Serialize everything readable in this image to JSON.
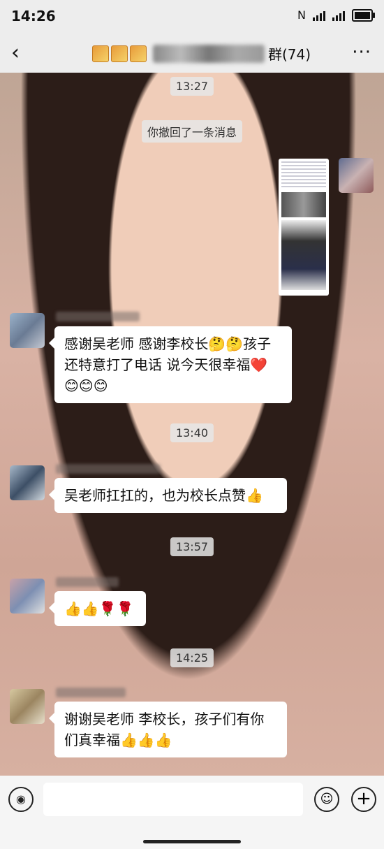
{
  "status_bar": {
    "time": "14:26",
    "nfc": "N",
    "battery_icon": "battery-charging-icon"
  },
  "header": {
    "title_suffix": "群(74)",
    "back_icon": "chevron-left-icon",
    "more_icon": "more-horizontal-icon",
    "back_glyph": "‹",
    "more_glyph": "···"
  },
  "messages": {
    "ts1": "13:27",
    "recall_notice": "你撤回了一条消息",
    "m1_line1": "感谢吴老师 感谢李校长🤔🤔孩子",
    "m1_line2": "还特意打了电话 说今天很幸福❤️",
    "m1_line3": "😊😊😊",
    "ts2": "13:40",
    "m2": "吴老师扛扛的，也为校长点赞👍",
    "ts3": "13:57",
    "m3": "👍👍🌹🌹",
    "ts4": "14:25",
    "m4_line1": "谢谢吴老师 李校长，孩子们有你",
    "m4_line2": "们真幸福👍👍👍"
  },
  "composer": {
    "voice_icon": "voice-icon",
    "emoji_icon": "emoji-icon",
    "plus_icon": "plus-icon",
    "voice_glyph": "◉",
    "emoji_glyph": "☺",
    "plus_glyph": "+"
  },
  "colors": {
    "bar_bg": "#ededed",
    "bubble": "#ffffff"
  }
}
